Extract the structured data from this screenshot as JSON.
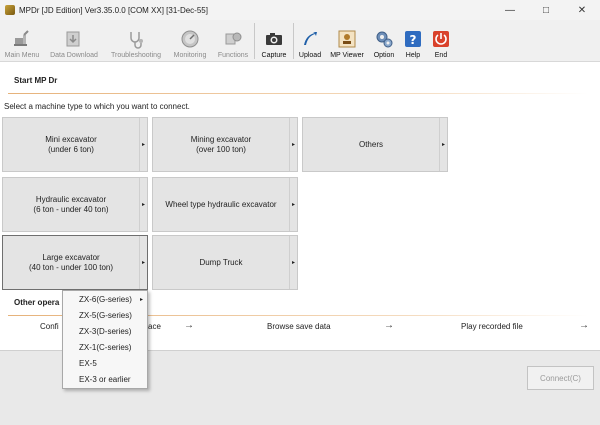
{
  "window": {
    "title": "MPDr [JD Edition] Ver3.35.0.0 [COM XX] [31-Dec-55]",
    "controls": [
      "—",
      "□",
      "✕"
    ]
  },
  "toolbar": {
    "items": [
      {
        "label": "Main Menu",
        "icon": "main-menu-icon",
        "enabled": false
      },
      {
        "label": "Data Download",
        "icon": "data-download-icon",
        "enabled": false
      },
      {
        "label": "Troubleshooting",
        "icon": "stethoscope-icon",
        "enabled": false
      },
      {
        "label": "Monitoring",
        "icon": "gauge-icon",
        "enabled": false
      },
      {
        "label": "Functions",
        "icon": "functions-icon",
        "enabled": false
      },
      {
        "label": "Capture",
        "icon": "camera-icon",
        "enabled": true
      },
      {
        "label": "Upload",
        "icon": "upload-icon",
        "enabled": true
      },
      {
        "label": "MP Viewer",
        "icon": "mp-viewer-icon",
        "enabled": true
      },
      {
        "label": "Option",
        "icon": "gears-icon",
        "enabled": true
      },
      {
        "label": "Help",
        "icon": "help-icon",
        "enabled": true
      },
      {
        "label": "End",
        "icon": "power-icon",
        "enabled": true
      }
    ]
  },
  "start": {
    "title": "Start MP Dr",
    "prompt": "Select a machine type to which you want to connect."
  },
  "machines": [
    {
      "line1": "Mini excavator",
      "line2": "(under 6 ton)"
    },
    {
      "line1": "Mining excavator",
      "line2": "(over 100 ton)"
    },
    {
      "line1": "Others",
      "line2": ""
    },
    {
      "line1": "Hydraulic excavator",
      "line2": "(6 ton - under 40 ton)"
    },
    {
      "line1": "Wheel type hydraulic excavator",
      "line2": ""
    },
    {
      "line1": "Large excavator",
      "line2": "(40 ton - under 100 ton)"
    },
    {
      "line1": "Dump Truck",
      "line2": ""
    }
  ],
  "tile_arrow": "▸",
  "other": {
    "title": "Other opera",
    "items": [
      {
        "label": "Confi",
        "tail": "ace"
      },
      {
        "label": "Browse save data"
      },
      {
        "label": "Play recorded file"
      }
    ],
    "arrow": "→"
  },
  "dropdown": {
    "items": [
      "ZX-6(G-series)",
      "ZX-5(G-series)",
      "ZX-3(D-series)",
      "ZX-1(C-series)",
      "EX-5",
      "EX-3 or earlier"
    ],
    "submenu_arrow": "▸"
  },
  "connect_button": "Connect(C)",
  "colors": {
    "accent_line": "#e6b27a",
    "tile_bg": "#e4e4e4",
    "toolbar_bg": "#f0f0f0"
  }
}
